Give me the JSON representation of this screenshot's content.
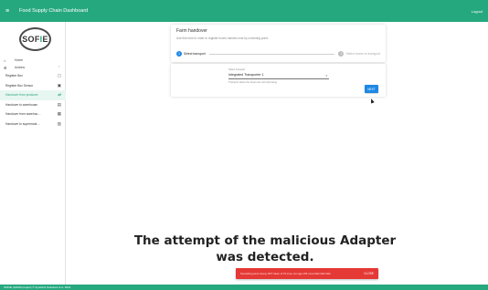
{
  "app": {
    "title": "Food Supply Chain Dashboard",
    "logout_label": "Logout",
    "menu_icon": "hamburger-icon"
  },
  "logo": {
    "text_pre": "SOF",
    "text_green": "I",
    "text_post": "E"
  },
  "sidebar": {
    "items": [
      {
        "label": "Home",
        "icon": "home-icon"
      },
      {
        "label": "Actions",
        "icon": "gear-icon"
      }
    ],
    "subitems": [
      {
        "label": "Register Box",
        "icon": "box-icon"
      },
      {
        "label": "Register Box Sensor",
        "icon": "sensor-icon"
      },
      {
        "label": "Handover from producer",
        "icon": "handover-icon",
        "active": true
      },
      {
        "label": "Handover to warehouse",
        "icon": "warehouse-icon"
      },
      {
        "label": "Handover from warehou…",
        "icon": "truck-icon"
      },
      {
        "label": "Handover to supermark…",
        "icon": "store-icon"
      }
    ]
  },
  "form": {
    "title": "Farm handover",
    "description": "Use this form in order to register boxes handed over by a farming point.",
    "steps": [
      {
        "number": "1",
        "label": "Select transport",
        "active": true
      },
      {
        "number": "2",
        "label": "Select boxes to transport",
        "active": false
      }
    ],
    "select": {
      "label": "Select transport",
      "value": "Integrated Transporter 1",
      "helper": "Transport where the boxes are currently being"
    },
    "next_label": "NEXT"
  },
  "caption": {
    "line1": "The attempt of the malicious Adapter",
    "line2": "was detected."
  },
  "snackbar": {
    "message": "Something went wrong: DFT token of 70 more min ago 156 more blah blah blah",
    "close_label": "CLOSE",
    "color": "#e53935"
  },
  "footer": {
    "text": "SOFIE (H2020 project) © Synelixis Solutions S.A. 2021"
  },
  "colors": {
    "accent": "#26a87e",
    "primary": "#1e88e5"
  }
}
